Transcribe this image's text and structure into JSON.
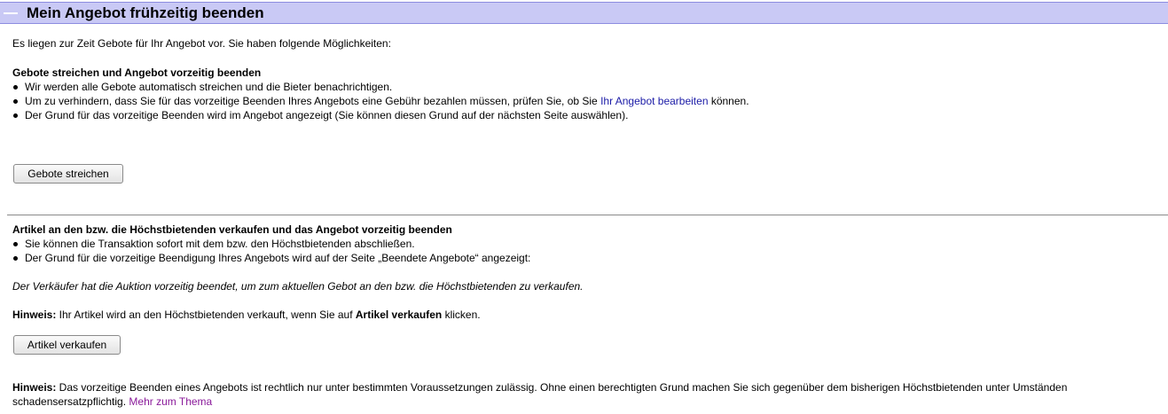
{
  "header": {
    "title": "Mein Angebot frühzeitig beenden"
  },
  "intro": "Es liegen zur Zeit Gebote für Ihr Angebot vor. Sie haben folgende Möglichkeiten:",
  "option1": {
    "heading": "Gebote streichen und Angebot vorzeitig beenden",
    "bullet1": "Wir werden alle Gebote automatisch streichen und die Bieter benachrichtigen.",
    "bullet2_pre": "Um zu verhindern, dass Sie für das vorzeitige Beenden Ihres Angebots eine Gebühr bezahlen müssen, prüfen Sie, ob Sie ",
    "bullet2_link": "Ihr Angebot bearbeiten",
    "bullet2_post": " können.",
    "bullet3": "Der Grund für das vorzeitige Beenden wird im Angebot angezeigt (Sie können diesen Grund auf der nächsten Seite auswählen).",
    "button_label": "Gebote streichen"
  },
  "option2": {
    "heading": "Artikel an den bzw. die Höchstbietenden verkaufen und das Angebot vorzeitig beenden",
    "bullet1": "Sie können die Transaktion sofort mit dem bzw. den Höchstbietenden abschließen.",
    "bullet2": "Der Grund für die vorzeitige Beendigung Ihres Angebots wird auf der Seite „Beendete Angebote“ angezeigt:",
    "reason_text": "Der Verkäufer hat die Auktion vorzeitig beendet, um zum aktuellen Gebot an den bzw. die Höchstbietenden zu verkaufen.",
    "hint_label": "Hinweis:",
    "hint_pre": " Ihr Artikel wird an den Höchstbietenden verkauft, wenn Sie auf ",
    "hint_bold": "Artikel verkaufen",
    "hint_post": " klicken.",
    "button_label": "Artikel verkaufen"
  },
  "footer": {
    "hint_label": "Hinweis:",
    "hint_line1": " Das vorzeitige Beenden eines Angebots ist rechtlich nur unter bestimmten Voraussetzungen zulässig. Ohne einen berechtigten Grund machen Sie sich gegenüber dem bisherigen Höchstbietenden unter Umständen",
    "hint_line2": "schadensersatzpflichtig. ",
    "link": "Mehr zum Thema"
  }
}
